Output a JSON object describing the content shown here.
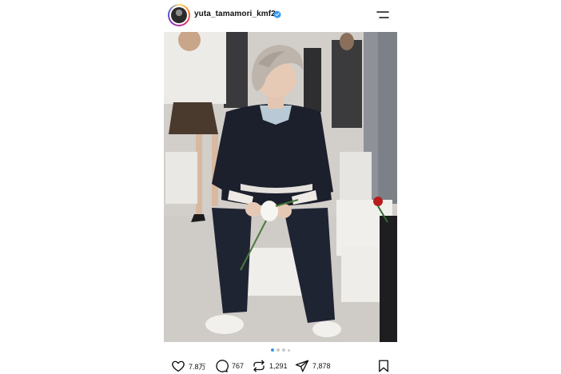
{
  "post": {
    "username": "yuta_tamamori_kmf2",
    "verified": true,
    "carousel": {
      "total": 4,
      "active_index": 0
    },
    "actions": {
      "likes": "7.8万",
      "comments": "767",
      "reposts": "1,291",
      "shares": "7,878"
    }
  },
  "colors": {
    "accent": "#3897f0",
    "text": "#111111"
  }
}
